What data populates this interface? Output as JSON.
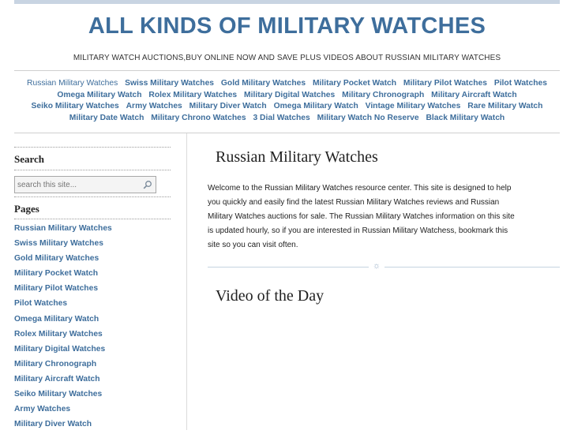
{
  "site": {
    "title": "ALL KINDS OF MILITARY WATCHES",
    "tagline": "MILITARY WATCH AUCTIONS,BUY ONLINE NOW AND SAVE PLUS VIDEOS ABOUT RUSSIAN MILITARY WATCHES"
  },
  "topnav": {
    "items": [
      {
        "label": "Russian Military Watches"
      },
      {
        "label": "Swiss Military Watches"
      },
      {
        "label": "Gold Military Watches"
      },
      {
        "label": "Military Pocket Watch"
      },
      {
        "label": "Military Pilot Watches"
      },
      {
        "label": "Pilot Watches"
      },
      {
        "label": "Omega Military Watch"
      },
      {
        "label": "Rolex Military Watches"
      },
      {
        "label": "Military Digital Watches"
      },
      {
        "label": "Military Chronograph"
      },
      {
        "label": "Military Aircraft Watch"
      },
      {
        "label": "Seiko Military Watches"
      },
      {
        "label": "Army Watches"
      },
      {
        "label": "Military Diver Watch"
      },
      {
        "label": "Omega Military Watch"
      },
      {
        "label": "Vintage Military Watches"
      },
      {
        "label": "Rare Military Watch"
      },
      {
        "label": "Military Date Watch"
      },
      {
        "label": "Military Chrono Watches"
      },
      {
        "label": "3 Dial Watches"
      },
      {
        "label": "Military Watch No Reserve"
      },
      {
        "label": "Black Military Watch"
      }
    ]
  },
  "sidebar": {
    "search_heading": "Search",
    "search_placeholder": "search this site...",
    "pages_heading": "Pages",
    "pages": [
      {
        "label": "Russian Military Watches"
      },
      {
        "label": "Swiss Military Watches"
      },
      {
        "label": "Gold Military Watches"
      },
      {
        "label": "Military Pocket Watch"
      },
      {
        "label": "Military Pilot Watches"
      },
      {
        "label": "Pilot Watches"
      },
      {
        "label": "Omega Military Watch"
      },
      {
        "label": "Rolex Military Watches"
      },
      {
        "label": "Military Digital Watches"
      },
      {
        "label": "Military Chronograph"
      },
      {
        "label": "Military Aircraft Watch"
      },
      {
        "label": "Seiko Military Watches"
      },
      {
        "label": "Army Watches"
      },
      {
        "label": "Military Diver Watch"
      }
    ]
  },
  "main": {
    "title": "Russian Military Watches",
    "intro": "Welcome to the Russian Military Watches resource center. This site is designed to help you quickly and easily find the latest Russian Military Watches reviews and Russian Military Watches auctions for sale. The Russian Military Watches information on this site is updated hourly, so if you are interested in Russian Military Watchess, bookmark this site so you can visit often.",
    "divider_icon": "sun-ornament-icon",
    "video_title": "Video of the Day"
  },
  "colors": {
    "link": "#3e6e9c",
    "title": "#3e6e9c",
    "top_bar": "#c8d4e2",
    "divider": "#c5d3e0"
  }
}
